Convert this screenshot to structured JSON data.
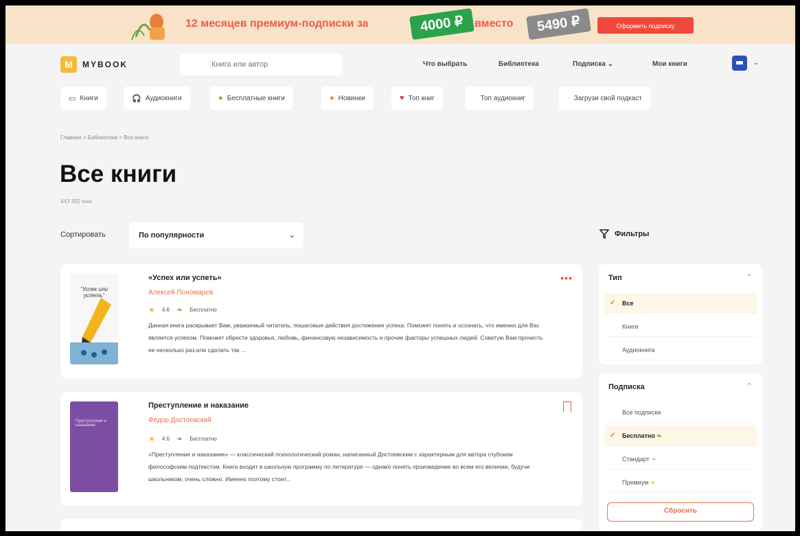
{
  "promo": {
    "text": "12 месяцев премиум-подписки за",
    "new_price": "4000 ₽",
    "middle": "вместо",
    "old_price": "5490 ₽",
    "button": "Оформить подписку"
  },
  "header": {
    "logo_text": "MYBOOK",
    "logo_letter": "M",
    "search_placeholder": "Книга или автор",
    "nav": [
      "Что выбрать",
      "Библиотека",
      "Подписка",
      "Мои книги"
    ]
  },
  "categories": [
    "Книги",
    "Аудиокниги",
    "Бесплатные книги",
    "Новинки",
    "Топ книг",
    "Топ аудиокниг",
    "Загрузи свой подкаст"
  ],
  "breadcrumb": [
    "Главная",
    "Библиотека",
    "Все книги"
  ],
  "page": {
    "title": "Все книги",
    "count": "443 392 книг"
  },
  "sort": {
    "label": "Сортировать",
    "value": "По популярности"
  },
  "filters": {
    "title": "Фильтры",
    "type": {
      "label": "Тип",
      "options": [
        "Все",
        "Книги",
        "Аудиокнига"
      ],
      "selected": "Все"
    },
    "subscription": {
      "label": "Подписка",
      "options": [
        "Все подписки",
        "Бесплатно",
        "Стандарт",
        "Премиум"
      ],
      "selected": "Бесплатно"
    },
    "reset": "Сбросить"
  },
  "books": [
    {
      "title": "«Успех или успеть»",
      "author": "Алексей Пономарев",
      "rating": "4.6",
      "badge": "Бесплатно",
      "cover_text": "\"Успех или успеть\"",
      "description": "Данная книга раскрывает Вам, уважаемый читатель, пошаговые действия достижения успеха. Поможет понять и осознать, что именно для Вас является успехом. Поможет обрести здоровье, любовь, финансовую независимость и прочие факторы успешных людей. Советую Вам прочесть ее несколько раз,или сделать так ..."
    },
    {
      "title": "Преступление и наказание",
      "author": "Федор Достоевский",
      "rating": "4.6",
      "badge": "Бесплатно",
      "cover_text": "Преступление и наказание",
      "description": "«Преступление и наказание» — классический психологический роман, написанный Достоевским с характерным для автора глубоким философским подтекстом. Книга входит в школьную программу по литературе — однако понять произведение во всем его величии, будучи школьником, очень сложно. Именно поэтому стоит..."
    }
  ],
  "colors": {
    "accent": "#e86f45",
    "promo_bg": "#f8e3c9",
    "price_new": "#2ba34a",
    "cover2": "#7b4ea3"
  }
}
